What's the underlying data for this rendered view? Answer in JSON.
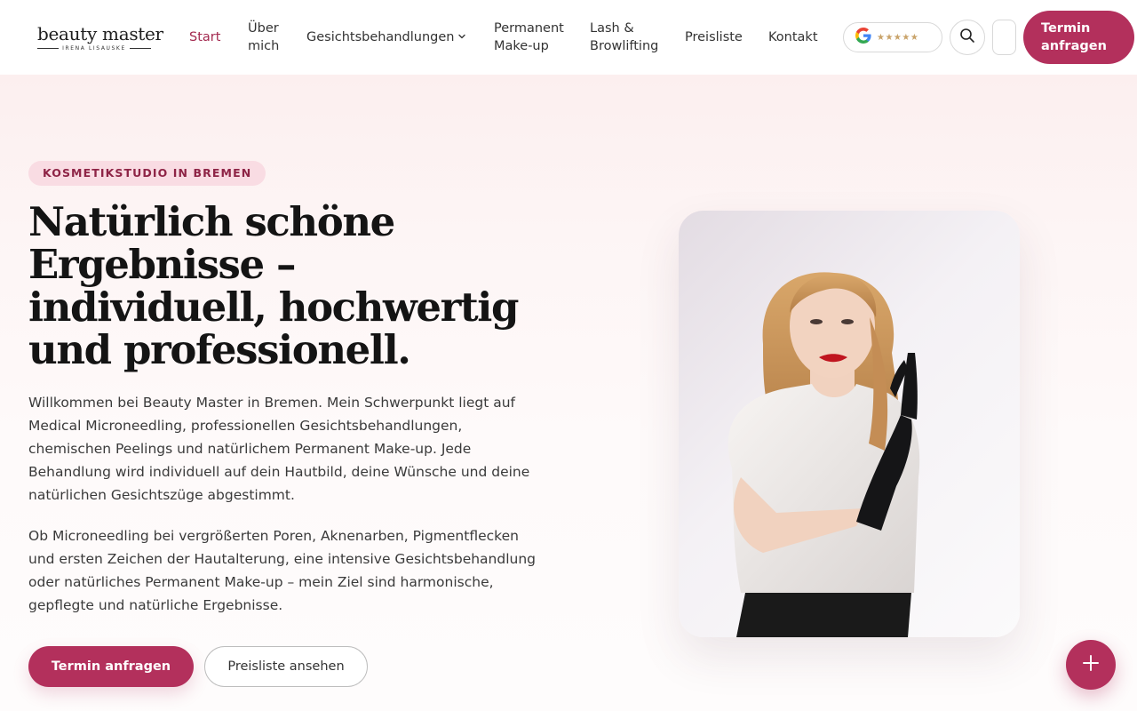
{
  "logo": {
    "name": "beauty master",
    "sub": "IRENA LISAUSKE"
  },
  "nav": [
    {
      "label": "Start"
    },
    {
      "label_line1": "Über",
      "label_line2": "mich"
    },
    {
      "label": "Gesichtsbehandlungen"
    },
    {
      "label_line1": "Permanent",
      "label_line2": "Make-up"
    },
    {
      "label_line1": "Lash &",
      "label_line2": "Browlifting"
    },
    {
      "label": "Preisliste"
    },
    {
      "label": "Kontakt"
    }
  ],
  "google_rating": {
    "stars": "★★★★★",
    "rating_out_of_5": 5
  },
  "header_cta": {
    "line1": "Termin",
    "line2": "anfragen"
  },
  "hero": {
    "badge": "KOSMETIKSTUDIO IN BREMEN",
    "title": "Natürlich schöne Ergebnisse – individuell, hochwertig und professionell.",
    "paragraph1": "Willkommen bei Beauty Master in Bremen. Mein Schwerpunkt liegt auf Medical Microneedling, professionellen Gesichtsbehandlungen, chemischen Peelings und natürlichem Permanent Make-up. Jede Behandlung wird individuell auf dein Hautbild, deine Wünsche und deine natürlichen Gesichtszüge abgestimmt.",
    "paragraph2": "Ob Microneedling bei vergrößerten Poren, Aknenarben, Pigmentflecken und ersten Zeichen der Hautalterung, eine intensive Gesichtsbehandlung oder natürliches Permanent Make-up – mein Ziel sind harmonische, gepflegte und natürliche Ergebnisse.",
    "primary_button": "Termin anfragen",
    "secondary_button": "Preisliste ansehen"
  },
  "colors": {
    "accent": "#b3305c",
    "badge_bg": "#f9dce3",
    "badge_text": "#8e2446",
    "active_nav": "#a3294f"
  }
}
